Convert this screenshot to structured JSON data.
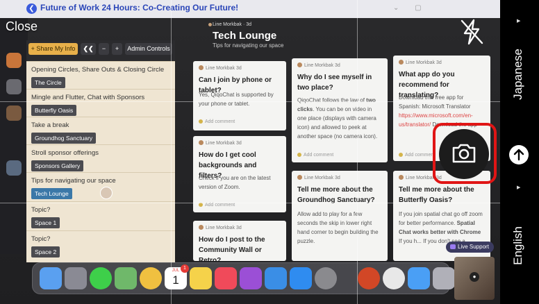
{
  "overlay": {
    "close_label": "Close",
    "source_language": "Japanese",
    "target_language": "English"
  },
  "event": {
    "title": "Future of Work 24 Hours: Co-Creating Our Future!"
  },
  "toolbar": {
    "share_label": "+ Share My Info",
    "collapse_label": "❮❮",
    "minus_label": "−",
    "plus_label": "+",
    "admin_label": "Admin Controls"
  },
  "sidebar": {
    "groups": [
      {
        "title": "Opening Circles, Share Outs & Closing Circle",
        "room": "The Circle"
      },
      {
        "title": "Mingle and Flutter, Chat with Sponsors",
        "room": "Butterfly Oasis"
      },
      {
        "title": "Take a break",
        "room": "Groundhog Sanctuary"
      },
      {
        "title": "Stroll sponsor offerings",
        "room": "Sponsors Gallery"
      },
      {
        "title": "Tips for navigating our space",
        "room": "Tech Lounge"
      },
      {
        "title": "Topic?",
        "room": "Space 1"
      },
      {
        "title": "Topic?",
        "room": "Space 2"
      }
    ]
  },
  "board": {
    "author": "Line Morkbak",
    "age": "3d",
    "title": "Tech Lounge",
    "subtitle": "Tips for navigating our space",
    "add_comment": "Add comment",
    "cards": [
      {
        "author": "Line Morkbak 3d",
        "question": "Can I join by phone or tablet?",
        "answer": "Yes, QiqoChat is supported by your phone or tablet."
      },
      {
        "author": "Line Morkbak 3d",
        "question": "Why do I see myself in two place?",
        "answer_pre": "QiqoChat follows the law of ",
        "answer_bold": "two clicks",
        "answer_post": ". You can be on video in one place (displays with camera icon) and allowed to peek at another space (no camera icon)."
      },
      {
        "author": "Line Morkbak 3d",
        "question": "What app do you recommend for translating?",
        "answer_pre": "Download this free app for Spanish: Microsoft Translator ",
        "answer_link": "https://www.microsoft.com/en-us/translator/",
        "answer_post": " Download the app"
      },
      {
        "author": "Line Morkbak 3d",
        "question": "How do I get cool backgrounds and filters?",
        "answer": "Check if you are on the latest version of Zoom."
      },
      {
        "author": "Line Morkbak 3d",
        "question": "Tell me more about the Groundhog Sanctuary?",
        "answer": "Allow add to play for a few seconds the skip in lower right hand corner to begin building the puzzle."
      },
      {
        "author": "Line Morkbak 3d",
        "question": "Tell me more about the Butterfly Oasis?",
        "answer_pre": "If you join spatial chat go off zoom for better performance. ",
        "answer_bold": "Spatial Chat works better with Chrome",
        "answer_post": " If you h... If you don't see a"
      },
      {
        "author": "Line Morkbak 3d",
        "question": "How do I post to the Community Wall or Retro?",
        "answer": ""
      }
    ],
    "live_support": "Live Support"
  },
  "dock": {
    "calendar_month": "JUL",
    "calendar_day": "1",
    "calendar_badge": "1",
    "apps": [
      {
        "name": "finder",
        "color": "#5aa0f0"
      },
      {
        "name": "launchpad",
        "color": "#8a8a94"
      },
      {
        "name": "messages",
        "color": "#3ecf4a"
      },
      {
        "name": "maps",
        "color": "#6fb86a"
      },
      {
        "name": "photos",
        "color": "#f0c040"
      },
      {
        "name": "calendar",
        "color": "#ffffff"
      },
      {
        "name": "notes",
        "color": "#f5d24a"
      },
      {
        "name": "music",
        "color": "#f04a5a"
      },
      {
        "name": "podcasts",
        "color": "#9b4fd6"
      },
      {
        "name": "keynote",
        "color": "#3a8ee6"
      },
      {
        "name": "app-store",
        "color": "#2f8cf0"
      },
      {
        "name": "settings",
        "color": "#8a8a8e"
      },
      {
        "name": "powerpoint",
        "color": "#d24726"
      },
      {
        "name": "chrome",
        "color": "#e8e8e8"
      },
      {
        "name": "mail",
        "color": "#4a9ff5"
      },
      {
        "name": "preview",
        "color": "#b0b0b8"
      }
    ]
  },
  "colors": {
    "accent": "#e01515",
    "event_title": "#2b46b8",
    "active_room": "#3b78a8"
  }
}
